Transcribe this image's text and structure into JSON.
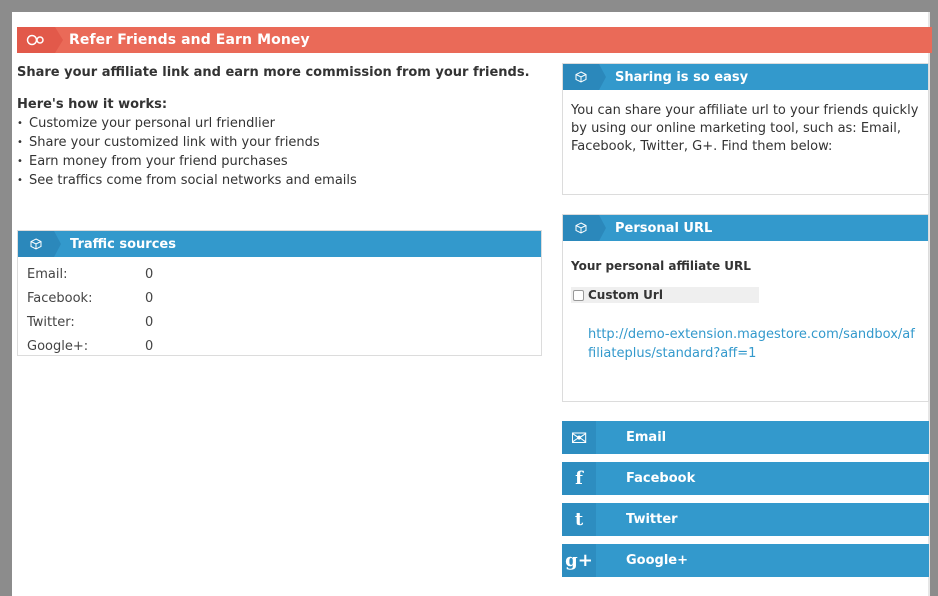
{
  "header": {
    "title": "Refer Friends and Earn Money",
    "icon": "referral-icon"
  },
  "intro": {
    "lead": "Share your affiliate link and earn more commission from your friends.",
    "how_title": "Here's how it works:",
    "steps": [
      "Customize your personal url friendlier",
      "Share your customized link with your friends",
      "Earn money from your friend purchases",
      "See traffics come from social networks and emails"
    ]
  },
  "traffic": {
    "title": "Traffic sources",
    "rows": [
      {
        "label": "Email:",
        "value": "0"
      },
      {
        "label": "Facebook:",
        "value": "0"
      },
      {
        "label": "Twitter:",
        "value": "0"
      },
      {
        "label": "Google+:",
        "value": "0"
      }
    ]
  },
  "sharing": {
    "title": "Sharing is so easy",
    "body": "You can share your affiliate url to your friends quickly by using our online marketing tool, such as: Email, Facebook, Twitter, G+. Find them below:"
  },
  "personal": {
    "title": "Personal URL",
    "label": "Your personal affiliate URL",
    "custom_label": "Custom Url",
    "custom_checked": false,
    "url": "http://demo-extension.magestore.com/sandbox/affiliateplus/standard?aff=1"
  },
  "share_buttons": [
    {
      "label": "Email",
      "icon": "mail-icon",
      "glyph": "✉"
    },
    {
      "label": "Facebook",
      "icon": "facebook-icon",
      "glyph": "f"
    },
    {
      "label": "Twitter",
      "icon": "twitter-icon",
      "glyph": "t"
    },
    {
      "label": "Google+",
      "icon": "google-plus-icon",
      "glyph": "g+"
    }
  ],
  "colors": {
    "header_red": "#ea6a58",
    "box_blue": "#3399cc",
    "link_blue": "#3399cc"
  }
}
